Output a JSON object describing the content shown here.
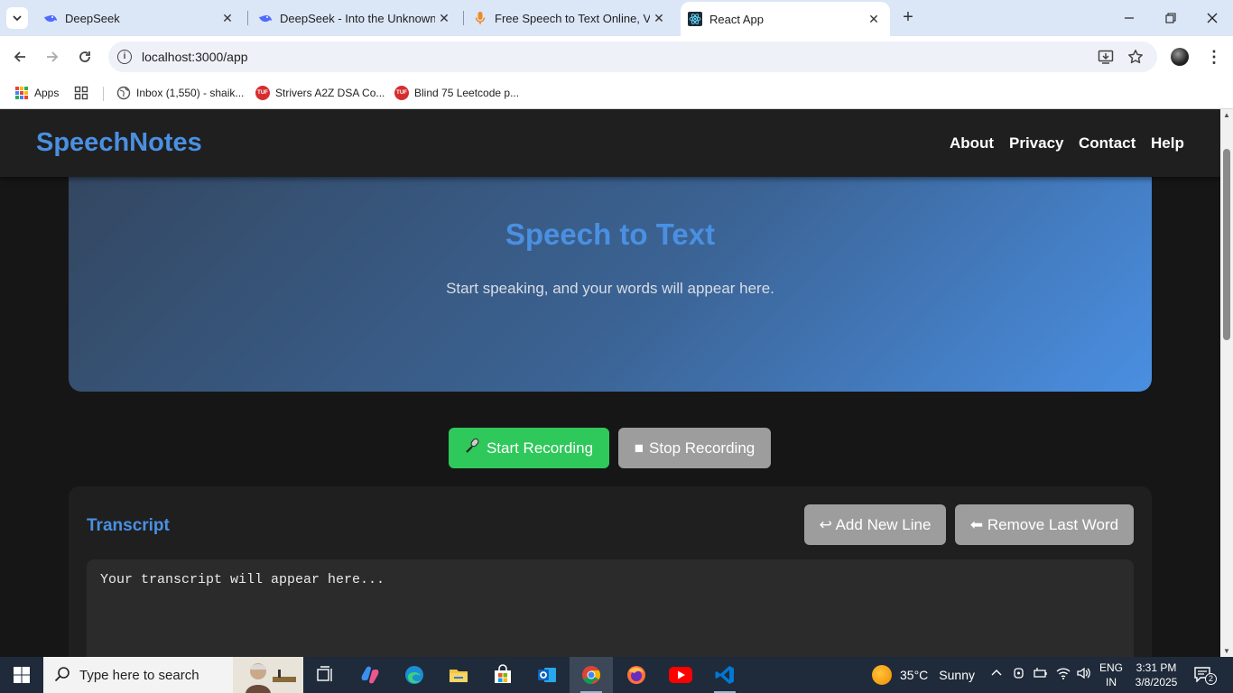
{
  "browser": {
    "tabs": [
      {
        "title": "DeepSeek",
        "icon": "deepseek-icon"
      },
      {
        "title": "DeepSeek - Into the Unknown",
        "icon": "deepseek-icon"
      },
      {
        "title": "Free Speech to Text Online, Voice Typing & Transcription",
        "icon": "microphone-icon"
      },
      {
        "title": "React App",
        "icon": "react-icon"
      }
    ],
    "url": "localhost:3000/app",
    "bookmarks": [
      {
        "label": "Apps",
        "icon": "apps-grid-icon"
      },
      {
        "label": "Inbox (1,550) - shaik...",
        "icon": "globe-icon"
      },
      {
        "label": "Strivers A2Z DSA Co...",
        "icon": "tuf-icon"
      },
      {
        "label": "Blind 75 Leetcode p...",
        "icon": "tuf-icon"
      }
    ],
    "tuf_text": "TUF"
  },
  "navbar": {
    "brand": "SpeechNotes",
    "links": [
      "About",
      "Privacy",
      "Contact",
      "Help"
    ]
  },
  "hero": {
    "title": "Speech to Text",
    "subtitle": "Start speaking, and your words will appear here."
  },
  "controls": {
    "start_label": "Start Recording",
    "start_icon": "🎤",
    "stop_label": "Stop Recording",
    "stop_icon": "■"
  },
  "transcript": {
    "title": "Transcript",
    "add_line_label": "↩ Add New Line",
    "remove_word_label": "⬅ Remove Last Word",
    "placeholder": "Your transcript will appear here..."
  },
  "taskbar": {
    "search_placeholder": "Type here to search",
    "weather_temp": "35°C",
    "weather_desc": "Sunny",
    "lang_line1": "ENG",
    "lang_line2": "IN",
    "time": "3:31 PM",
    "date": "3/8/2025",
    "notification_count": "2"
  },
  "colors": {
    "accent": "#4a90e2",
    "start_button": "#2fc85a",
    "neutral_button": "#9d9d9d",
    "page_bg": "#161616",
    "navbar_bg": "#1f1f1f"
  }
}
